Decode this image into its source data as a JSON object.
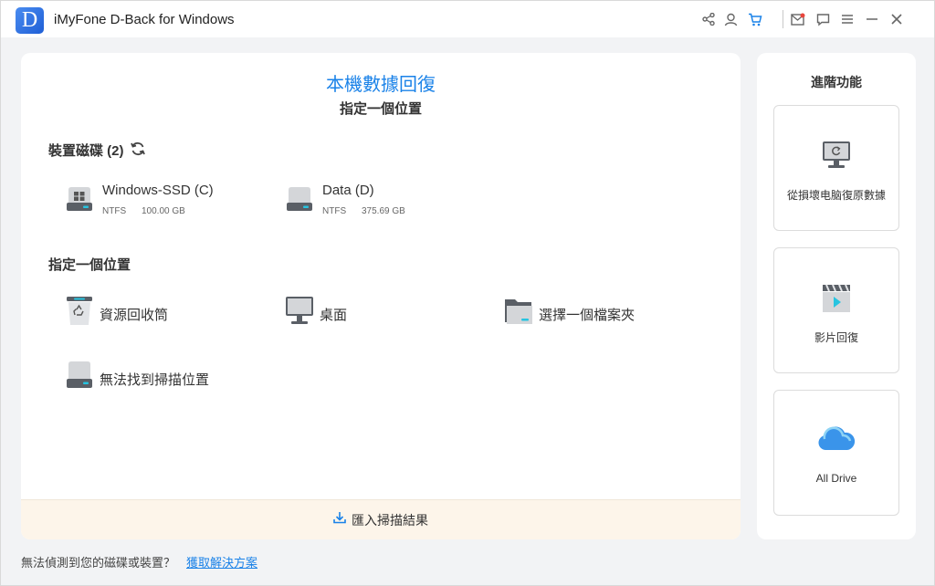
{
  "window": {
    "logo_letter": "D",
    "title": "iMyFone D-Back for Windows",
    "accent_color": "#1a82e8",
    "toolbar_icons": [
      "share-icon",
      "user-icon",
      "cart-icon",
      "mail-icon",
      "feedback-icon",
      "menu-icon",
      "minimize-icon",
      "close-icon"
    ]
  },
  "main": {
    "title": "本機數據回復",
    "subtitle": "指定一個位置",
    "devices_section_label": "裝置磁碟 (2)",
    "drives": [
      {
        "name": "Windows-SSD (C)",
        "filesystem": "NTFS",
        "size": "100.00 GB",
        "icon": "windows-drive-icon"
      },
      {
        "name": "Data (D)",
        "filesystem": "NTFS",
        "size": "375.69 GB",
        "icon": "hard-drive-icon"
      }
    ],
    "locations_section_label": "指定一個位置",
    "locations": [
      {
        "label": "資源回收筒",
        "icon": "recycle-bin-icon"
      },
      {
        "label": "桌面",
        "icon": "desktop-icon"
      },
      {
        "label": "選擇一個檔案夾",
        "icon": "folder-icon"
      },
      {
        "label": "無法找到掃描位置",
        "icon": "drive-icon"
      }
    ],
    "import_label": "匯入掃描結果"
  },
  "side": {
    "title": "進階功能",
    "cards": [
      {
        "label": "從損壞电脑復原數據",
        "icon": "crashed-computer-icon"
      },
      {
        "label": "影片回復",
        "icon": "video-clapper-icon"
      },
      {
        "label": "All Drive",
        "icon": "cloud-icon"
      }
    ]
  },
  "footer": {
    "note": "無法偵測到您的磁碟或裝置？",
    "link": "獲取解決方案"
  }
}
